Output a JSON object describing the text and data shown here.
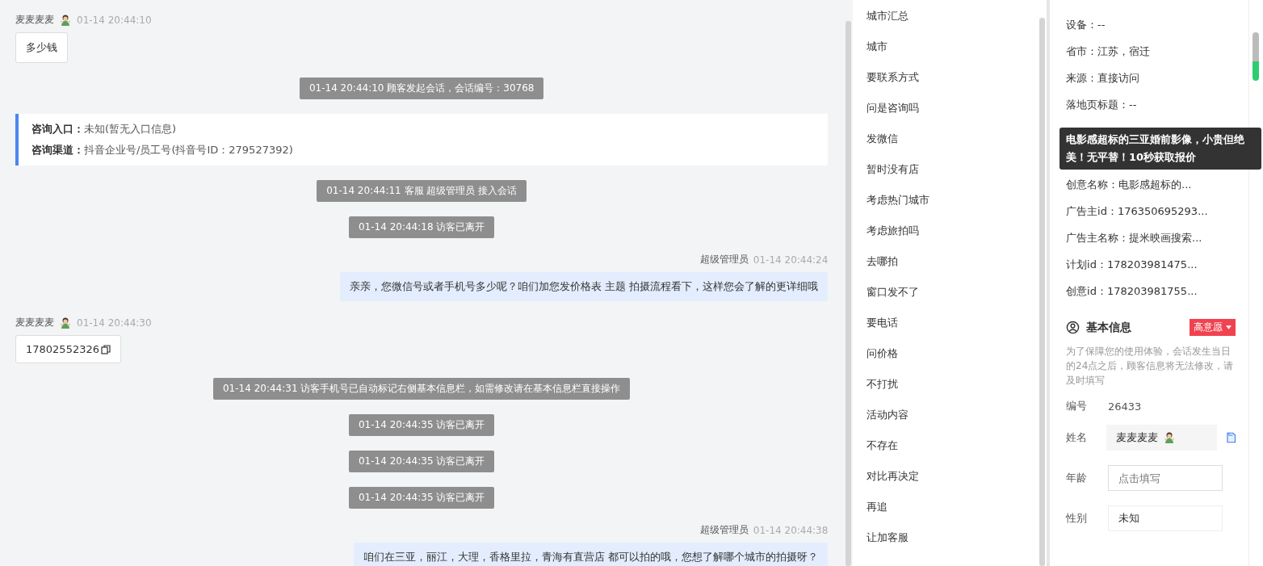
{
  "chat": {
    "messages": [
      {
        "kind": "visitor",
        "sender": "麦麦麦麦",
        "time": "01-14 20:44:10",
        "text": "多少钱",
        "copyable": false
      },
      {
        "kind": "system",
        "text": "01-14 20:44:10 顾客发起会话，会话编号：30768"
      },
      {
        "kind": "info",
        "lines": [
          {
            "label": "咨询入口：",
            "value": "未知(暂无入口信息)"
          },
          {
            "label": "咨询渠道：",
            "value": "抖音企业号/员工号(抖音号ID：279527392)"
          }
        ]
      },
      {
        "kind": "system",
        "text": "01-14 20:44:11 客服 超级管理员 接入会话"
      },
      {
        "kind": "system",
        "text": "01-14 20:44:18 访客已离开"
      },
      {
        "kind": "agent",
        "sender": "超级管理员",
        "time": "01-14 20:44:24",
        "text": "亲亲，您微信号或者手机号多少呢？咱们加您发价格表 主题 拍摄流程看下，这样您会了解的更详细哦"
      },
      {
        "kind": "visitor",
        "sender": "麦麦麦麦",
        "time": "01-14 20:44:30",
        "text": "17802552326",
        "copyable": true
      },
      {
        "kind": "system",
        "text": "01-14 20:44:31 访客手机号已自动标记右侧基本信息栏，如需修改请在基本信息栏直接操作"
      },
      {
        "kind": "system",
        "text": "01-14 20:44:35 访客已离开"
      },
      {
        "kind": "system",
        "text": "01-14 20:44:35 访客已离开"
      },
      {
        "kind": "system",
        "text": "01-14 20:44:35 访客已离开"
      },
      {
        "kind": "agent",
        "sender": "超级管理员",
        "time": "01-14 20:44:38",
        "text": "咱们在三亚，丽江，大理，香格里拉，青海有直营店 都可以拍的哦，您想了解哪个城市的拍摄呀？"
      }
    ]
  },
  "quick_replies": {
    "items": [
      "城市汇总",
      "城市",
      "要联系方式",
      "问是咨询吗",
      "发微信",
      "暂时没有店",
      "考虑热门城市",
      "考虑旅拍吗",
      "去哪拍",
      "窗口发不了",
      "要电话",
      "问价格",
      "不打扰",
      "活动内容",
      "不存在",
      "对比再决定",
      "再追",
      "让加客服"
    ]
  },
  "visitor_info": {
    "rows_before": [
      "设备：--",
      "省市：江苏，宿迁",
      "来源：直接访问",
      "落地页标题：--"
    ],
    "tooltip": "电影感超标的三亚婚前影像，小贵但绝美！无平替！10秒获取报价",
    "rows_after": [
      "创意名称：电影感超标的...",
      "广告主id：176350695293...",
      "广告主名称：提米映画搜索...",
      "计划id：178203981475...",
      "创意id：178203981755..."
    ]
  },
  "basic_info": {
    "title": "基本信息",
    "intent_tag": "高意愿",
    "notice": "为了保障您的使用体验，会话发生当日的24点之后，顾客信息将无法修改，请及时填写",
    "fields": [
      {
        "kind": "plain",
        "label": "编号",
        "value": "26433"
      },
      {
        "kind": "name",
        "label": "姓名",
        "value": "麦麦麦麦"
      },
      {
        "kind": "input",
        "label": "年龄",
        "placeholder": "点击填写"
      },
      {
        "kind": "select",
        "label": "性别",
        "value": "未知"
      }
    ]
  }
}
